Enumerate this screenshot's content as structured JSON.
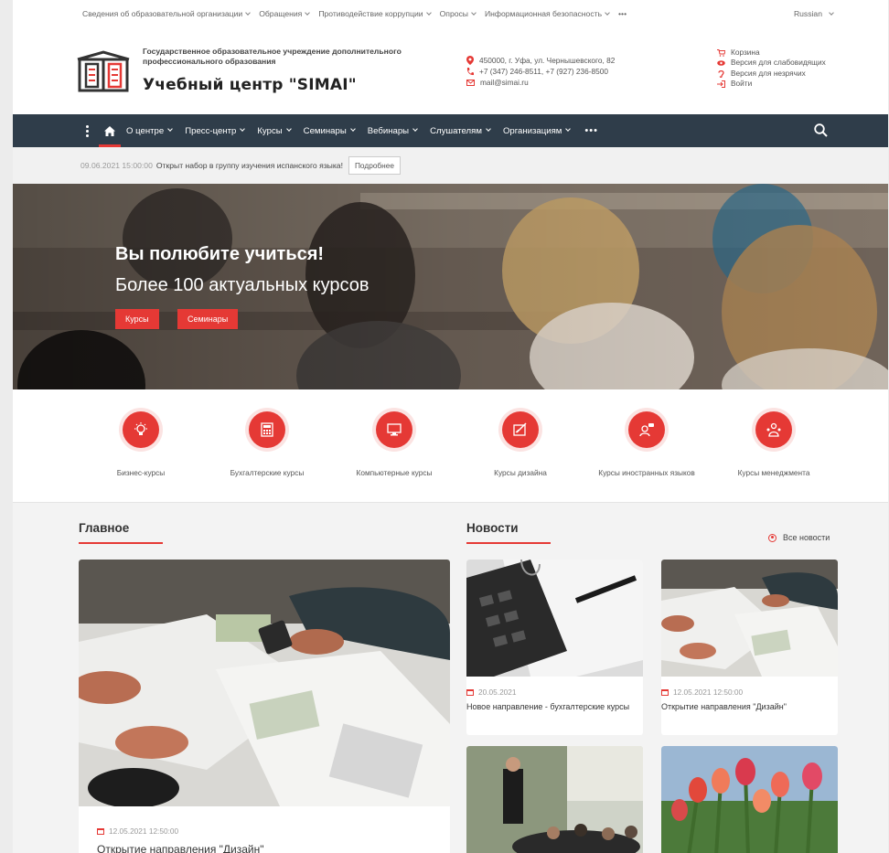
{
  "topbar": {
    "items": [
      "Сведения об образовательной организации",
      "Обращения",
      "Противодействие коррупции",
      "Опросы",
      "Информационная безопасность"
    ],
    "more": "•••",
    "language": "Russian"
  },
  "header": {
    "org_line": "Государственное образовательное учреждение дополнительного профессионального образования",
    "org_name": "Учебный центр \"SIMAI\"",
    "address": "450000, г. Уфа, ул. Чернышевского, 82",
    "phone": "+7 (347) 246-8511, +7 (927) 236-8500",
    "email": "mail@simai.ru",
    "cart": "Корзина",
    "low_vision": "Версия для слабовидящих",
    "hearing": "Версия для незрячих",
    "login": "Войти"
  },
  "nav": {
    "items": [
      "О центре",
      "Пресс-центр",
      "Курсы",
      "Семинары",
      "Вебинары",
      "Слушателям",
      "Организациям"
    ],
    "more": "•••"
  },
  "announce": {
    "date": "09.06.2021 15:00:00",
    "text": "Открыт набор в группу изучения испанского языка!",
    "button": "Подробнее"
  },
  "hero": {
    "title": "Вы полюбите учиться!",
    "subtitle": "Более 100 актуальных курсов",
    "btn_courses": "Курсы",
    "btn_seminars": "Семинары"
  },
  "categories": [
    {
      "label": "Бизнес-курсы",
      "icon": "bulb-icon"
    },
    {
      "label": "Бухгалтерские курсы",
      "icon": "calculator-icon"
    },
    {
      "label": "Компьютерные курсы",
      "icon": "computer-icon"
    },
    {
      "label": "Курсы дизайна",
      "icon": "design-icon"
    },
    {
      "label": "Курсы иностранных языков",
      "icon": "language-icon"
    },
    {
      "label": "Курсы менеджмента",
      "icon": "team-icon"
    }
  ],
  "main_section": {
    "title": "Главное",
    "date": "12.05.2021 12:50:00",
    "headline": "Открытие направления \"Дизайн\""
  },
  "news_section": {
    "title": "Новости",
    "all_news": "Все новости",
    "items": [
      {
        "date": "20.05.2021",
        "title": "Новое направление - бухгалтерские курсы"
      },
      {
        "date": "12.05.2021 12:50:00",
        "title": "Открытие направления \"Дизайн\""
      }
    ]
  },
  "colors": {
    "accent": "#e53935",
    "nav_bg": "#2f3d4a"
  }
}
